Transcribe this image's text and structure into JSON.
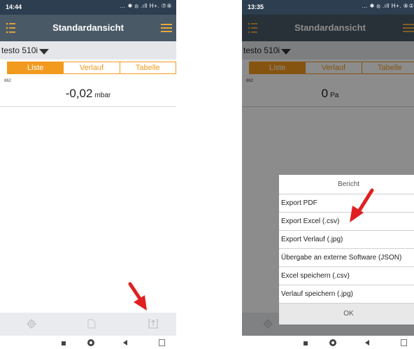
{
  "phone1": {
    "status_time": "14:44",
    "status_icons": "… ✱ ⦻ .ıll H+. ⑦⑧",
    "title": "Standardansicht",
    "device": "testo 510i",
    "tabs": [
      {
        "label": "Liste",
        "active": true
      },
      {
        "label": "Verlauf",
        "active": false
      },
      {
        "label": "Tabelle",
        "active": false
      }
    ],
    "measurement": {
      "id": "862",
      "value": "-0,02",
      "unit": "mbar"
    }
  },
  "phone2": {
    "status_time": "13:35",
    "status_icons": "… ✱ ⦻ .ıll H+. ⑧②",
    "title": "Standardansicht",
    "device": "testo 510i",
    "tabs": [
      {
        "label": "Liste",
        "active": true
      },
      {
        "label": "Verlauf",
        "active": false
      },
      {
        "label": "Tabelle",
        "active": false
      }
    ],
    "measurement": {
      "id": "862",
      "value": "0",
      "unit": "Pa"
    },
    "dialog": {
      "title": "Bericht",
      "items": [
        "Export PDF",
        "Export Excel (.csv)",
        "Export Verlauf (.jpg)",
        "Übergabe an externe Software (JSON)",
        "Excel speichern (.csv)",
        "Verlauf speichern (.jpg)"
      ],
      "ok": "OK"
    }
  },
  "icons": [
    "menu-list-icon",
    "hamburger-icon",
    "dropdown-triangle-icon",
    "settings-gear-icon",
    "document-icon",
    "export-icon",
    "red-arrow-icon",
    "nav-square-icon",
    "nav-home-icon",
    "nav-back-icon",
    "nav-other-icon"
  ],
  "colors": {
    "accent": "#f29a1d",
    "appbar": "#4a5966",
    "statusbar": "#2c3e50",
    "arrow": "#e02020"
  }
}
